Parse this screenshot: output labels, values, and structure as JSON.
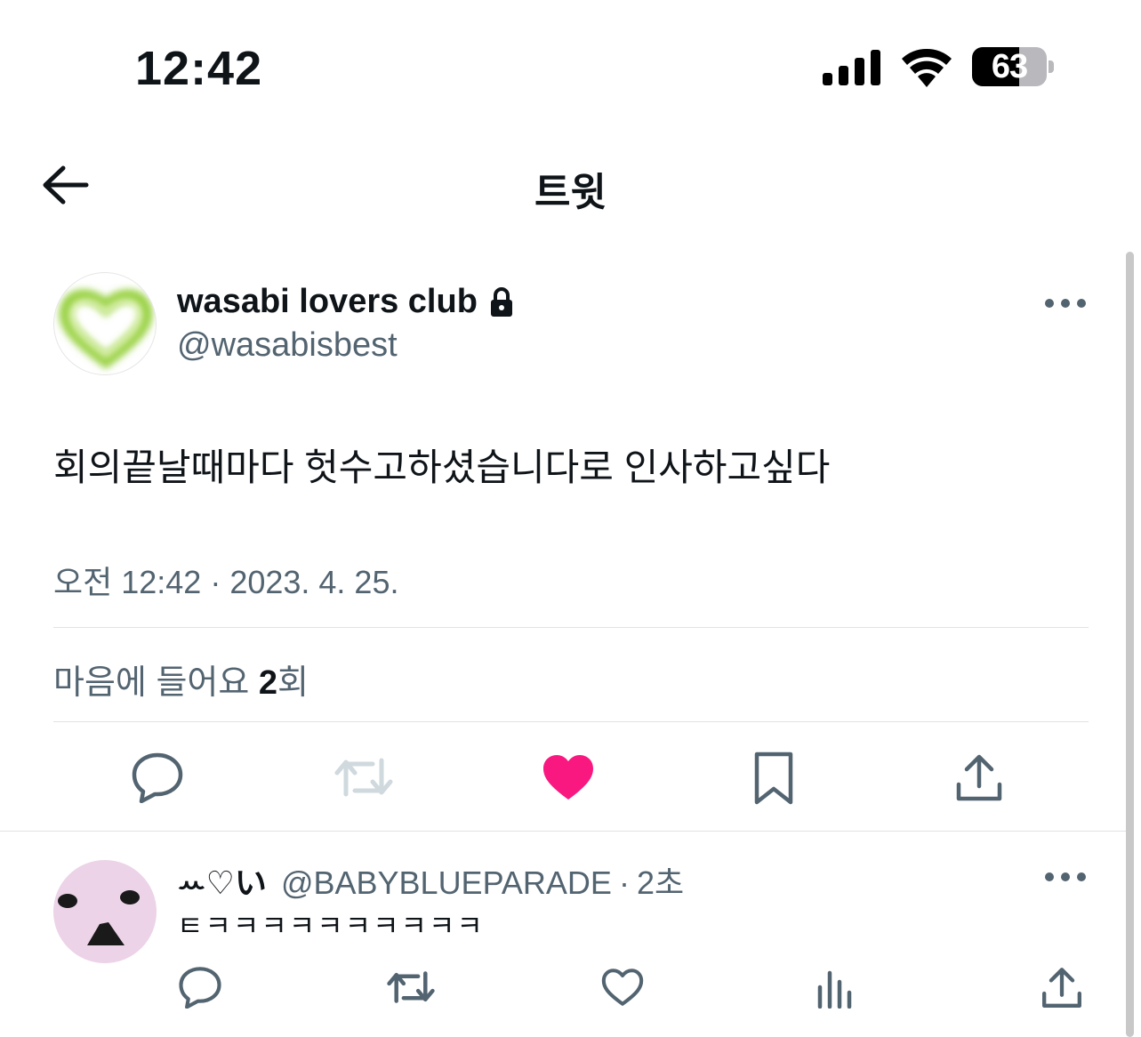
{
  "status_bar": {
    "time": "12:42",
    "battery_percent": "63",
    "battery_level": 0.63
  },
  "header": {
    "title": "트윗"
  },
  "tweet": {
    "display_name": "wasabi lovers club",
    "handle": "@wasabisbest",
    "protected": true,
    "text": "회의끝날때마다 헛수고하셨습니다로 인사하고싶다",
    "timestamp": "오전 12:42 · 2023. 4. 25.",
    "likes": {
      "prefix": "마음에 들어요 ",
      "count": "2",
      "suffix": "회"
    },
    "liked_by_viewer": true,
    "icons": [
      "back-arrow-icon",
      "lock-icon",
      "more-icon",
      "reply-icon",
      "retweet-icon",
      "heart-icon",
      "bookmark-icon",
      "share-icon"
    ]
  },
  "reply": {
    "display_name": "ꕀ♡い",
    "handle": "@BABYBLUEPARADE",
    "separator": "·",
    "time": "2초",
    "text": "ㅌㅋㅋㅋㅋㅋㅋㅋㅋㅋㅋ",
    "icons": [
      "reply-icon",
      "retweet-icon",
      "heart-icon",
      "analytics-icon",
      "share-icon"
    ]
  },
  "colors": {
    "text": "#0f1419",
    "secondary": "#536471",
    "like": "#f91880",
    "divider": "#dfe3e8",
    "disabled": "#cfd9de"
  }
}
